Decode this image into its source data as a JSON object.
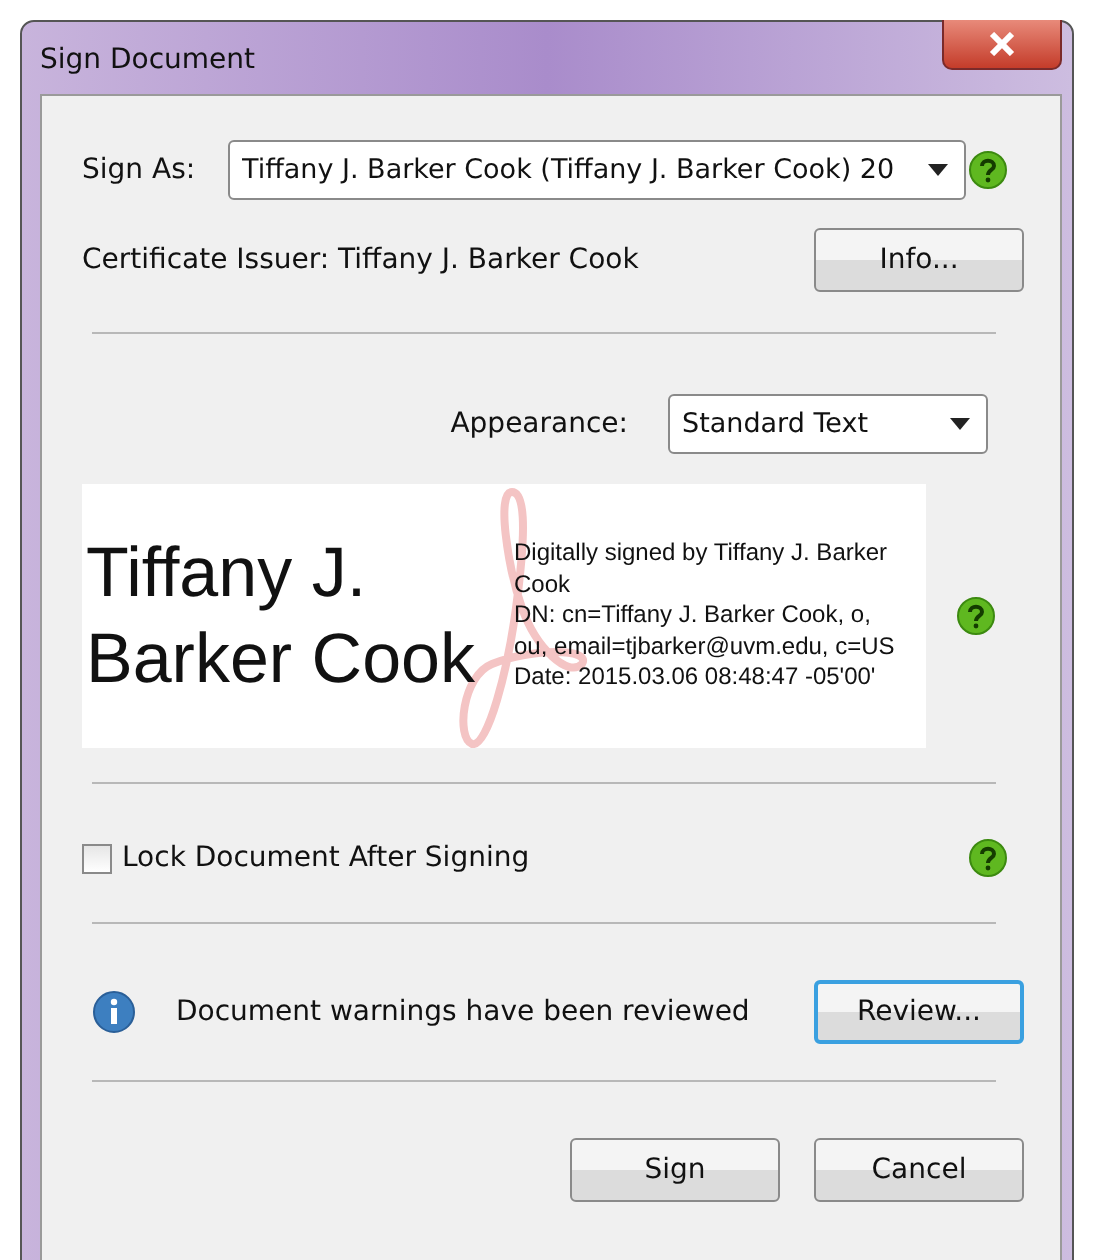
{
  "window": {
    "title": "Sign Document"
  },
  "sign_as": {
    "label": "Sign As:",
    "value": "Tiffany J. Barker Cook (Tiffany J. Barker Cook) 20"
  },
  "certificate_issuer": "Certificate Issuer: Tiffany J. Barker Cook",
  "info_button": "Info...",
  "appearance": {
    "label": "Appearance:",
    "value": "Standard Text"
  },
  "signature_preview": {
    "name": "Tiffany J. Barker Cook",
    "details": [
      "Digitally signed by Tiffany J. Barker Cook",
      "DN: cn=Tiffany J. Barker Cook, o, ou, email=tjbarker@uvm.edu, c=US",
      "Date: 2015.03.06 08:48:47 -05'00'"
    ]
  },
  "lock_document": {
    "label": "Lock Document After Signing",
    "checked": false
  },
  "warnings": {
    "text": "Document warnings have been reviewed",
    "button": "Review...",
    "focused": true
  },
  "buttons": [
    "Sign",
    "Cancel"
  ]
}
